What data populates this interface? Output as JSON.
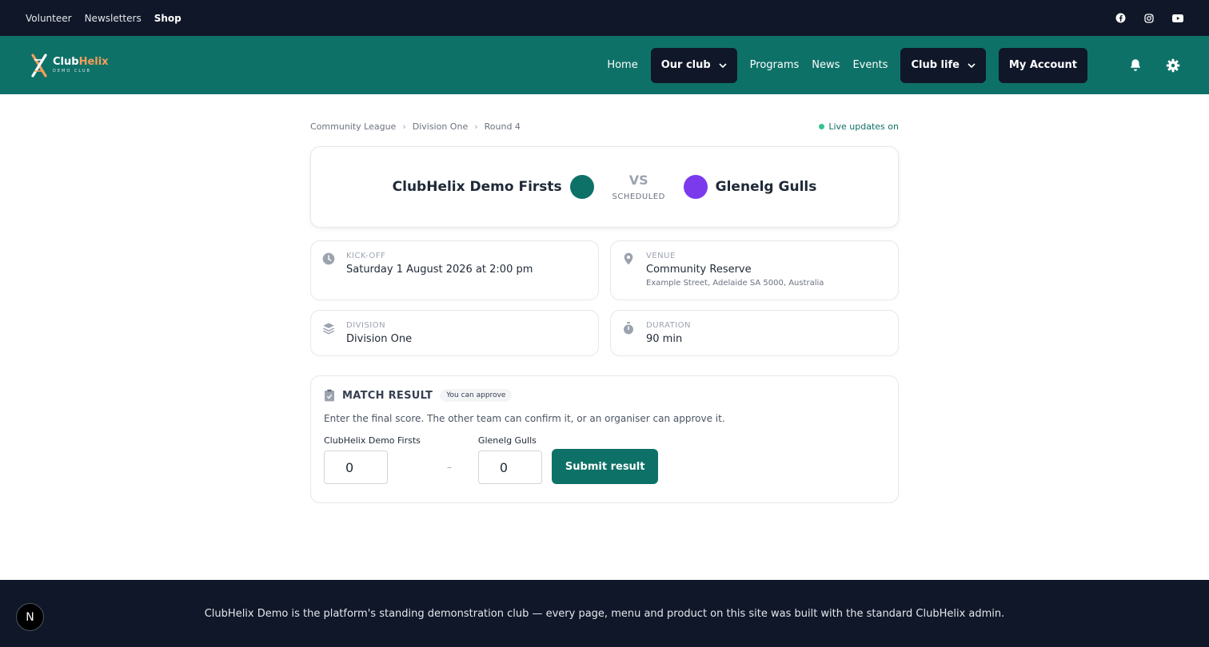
{
  "topbar": {
    "links": [
      "Volunteer",
      "Newsletters",
      "Shop"
    ],
    "social": [
      "facebook-icon",
      "instagram-icon",
      "youtube-icon"
    ]
  },
  "brand": {
    "name_part1": "Club",
    "name_part2": "Helix",
    "tagline": "DEMO CLUB",
    "accent_color": "#f59e5b"
  },
  "nav": {
    "home": "Home",
    "our_club": "Our club",
    "programs": "Programs",
    "news": "News",
    "events": "Events",
    "club_life": "Club life",
    "my_account": "My Account",
    "color": "#0e7168"
  },
  "breadcrumb": {
    "items": [
      "Community League",
      "Division One",
      "Round 4"
    ],
    "separator": "›"
  },
  "live_status": "Live updates on",
  "match": {
    "home_team": "ClubHelix Demo Firsts",
    "home_color": "#0e7168",
    "away_team": "Glenelg Gulls",
    "away_color": "#7c3aed",
    "vs_label": "VS",
    "status": "SCHEDULED"
  },
  "details": {
    "kickoff": {
      "label": "KICK-OFF",
      "value": "Saturday 1 August 2026 at 2:00 pm"
    },
    "venue": {
      "label": "VENUE",
      "value": "Community Reserve",
      "address": "Example Street, Adelaide SA 5000, Australia"
    },
    "division": {
      "label": "DIVISION",
      "value": "Division One"
    },
    "duration": {
      "label": "DURATION",
      "value": "90 min"
    }
  },
  "result": {
    "title": "MATCH RESULT",
    "badge": "You can approve",
    "description": "Enter the final score. The other team can confirm it, or an organiser can approve it.",
    "home_label": "ClubHelix Demo Firsts",
    "home_score": "0",
    "away_label": "Glenelg Gulls",
    "away_score": "0",
    "separator": "–",
    "submit_label": "Submit result"
  },
  "footer": {
    "text": "ClubHelix Demo is the platform's standing demonstration club — every page, menu and product on this site was built with the standard ClubHelix admin."
  },
  "dev_badge": "N"
}
